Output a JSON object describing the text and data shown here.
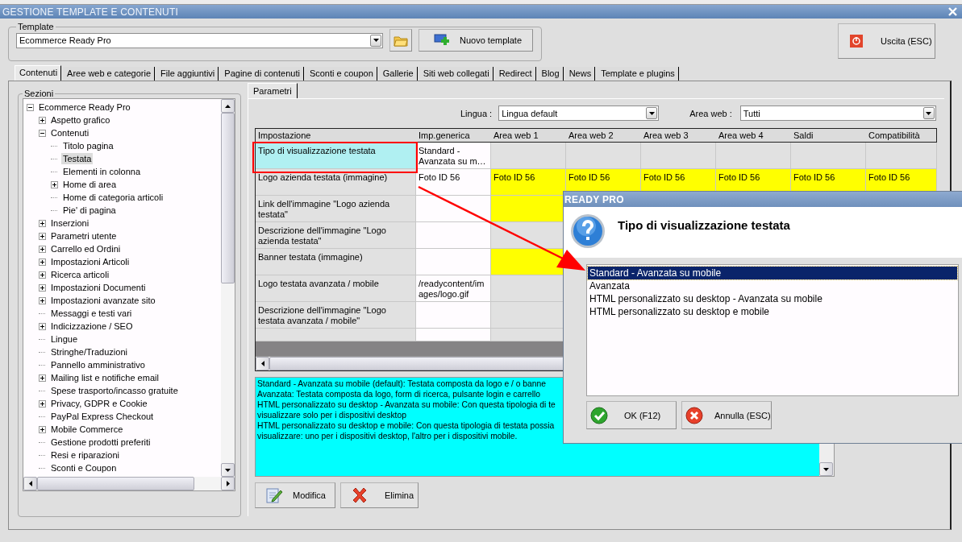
{
  "window": {
    "title": "GESTIONE TEMPLATE E CONTENUTI"
  },
  "template": {
    "label": "Template",
    "value": "Ecommerce Ready Pro",
    "new_button": "Nuovo template"
  },
  "exit_button": "Uscita (ESC)",
  "tabs": [
    {
      "label": "Contenuti",
      "selected": true
    },
    {
      "label": "Aree web e categorie",
      "selected": false
    },
    {
      "label": "File aggiuntivi",
      "selected": false
    },
    {
      "label": "Pagine di contenuti",
      "selected": false
    },
    {
      "label": "Sconti e coupon",
      "selected": false
    },
    {
      "label": "Gallerie",
      "selected": false
    },
    {
      "label": "Siti web collegati",
      "selected": false
    },
    {
      "label": "Redirect",
      "selected": false
    },
    {
      "label": "Blog",
      "selected": false
    },
    {
      "label": "News",
      "selected": false
    },
    {
      "label": "Template e plugins",
      "selected": false
    }
  ],
  "sections": {
    "label": "Sezioni",
    "tree": [
      {
        "label": "Ecommerce Ready Pro",
        "expanded": true,
        "selected": false,
        "children": [
          {
            "label": "Aspetto grafico",
            "expanded": false,
            "selected": false
          },
          {
            "label": "Contenuti",
            "expanded": true,
            "selected": false,
            "children": [
              {
                "label": "Titolo pagina",
                "selected": false
              },
              {
                "label": "Testata",
                "selected": true
              },
              {
                "label": "Elementi in colonna",
                "selected": false
              },
              {
                "label": "Home di area",
                "expanded": false,
                "selected": false
              },
              {
                "label": "Home di categoria articoli",
                "selected": false
              },
              {
                "label": "Pie' di pagina",
                "selected": false
              }
            ]
          },
          {
            "label": "Inserzioni",
            "expanded": false,
            "selected": false
          },
          {
            "label": "Parametri utente",
            "expanded": false,
            "selected": false
          },
          {
            "label": "Carrello ed Ordini",
            "expanded": false,
            "selected": false
          },
          {
            "label": "Impostazioni Articoli",
            "expanded": false,
            "selected": false
          },
          {
            "label": "Ricerca articoli",
            "expanded": false,
            "selected": false
          },
          {
            "label": "Impostazioni Documenti",
            "expanded": false,
            "selected": false
          },
          {
            "label": "Impostazioni avanzate sito",
            "expanded": false,
            "selected": false
          },
          {
            "label": "Messaggi e testi vari",
            "selected": false
          },
          {
            "label": "Indicizzazione / SEO",
            "expanded": false,
            "selected": false
          },
          {
            "label": "Lingue",
            "selected": false
          },
          {
            "label": "Stringhe/Traduzioni",
            "selected": false
          },
          {
            "label": "Pannello amministrativo",
            "selected": false
          },
          {
            "label": "Mailing list e notifiche email",
            "expanded": false,
            "selected": false
          },
          {
            "label": "Spese trasporto/incasso gratuite",
            "selected": false
          },
          {
            "label": "Privacy, GDPR e Cookie",
            "expanded": false,
            "selected": false
          },
          {
            "label": "PayPal Express Checkout",
            "selected": false
          },
          {
            "label": "Mobile Commerce",
            "expanded": false,
            "selected": false
          },
          {
            "label": "Gestione prodotti preferiti",
            "selected": false
          },
          {
            "label": "Resi e riparazioni",
            "selected": false
          },
          {
            "label": "Sconti e Coupon",
            "selected": false
          }
        ]
      }
    ]
  },
  "subtabs": [
    {
      "label": "Parametri",
      "selected": true
    }
  ],
  "filters": {
    "language_label": "Lingua :",
    "language": "Lingua default",
    "area_label": "Area web :",
    "area": "Tutti"
  },
  "grid": {
    "columns": [
      "Impostazione",
      "Imp.generica",
      "Area web 1",
      "Area web 2",
      "Area web 3",
      "Area web 4",
      "Saldi",
      "Compatibilità"
    ],
    "rows": [
      {
        "selected": true,
        "cells": [
          {
            "text": "Tipo di visualizzazione testata"
          },
          {
            "text": "Standard - Avanzata su m…"
          },
          {
            "highlighted": false
          },
          {
            "highlighted": false
          },
          {
            "highlighted": false
          },
          {
            "highlighted": false
          },
          {
            "highlighted": false
          },
          {
            "highlighted": false
          }
        ]
      },
      {
        "selected": false,
        "cells": [
          {
            "text": "Logo azienda testata (immagine)"
          },
          {
            "text": "Foto ID 56"
          },
          {
            "text": "Foto ID 56",
            "highlighted": true
          },
          {
            "text": "Foto ID 56",
            "highlighted": true
          },
          {
            "text": "Foto ID 56",
            "highlighted": true
          },
          {
            "text": "Foto ID 56",
            "highlighted": true
          },
          {
            "text": "Foto ID 56",
            "highlighted": true
          },
          {
            "text": "Foto ID 56",
            "highlighted": true
          }
        ]
      },
      {
        "selected": false,
        "cells": [
          {
            "text": "Link dell'immagine \"Logo azienda testata\""
          },
          {},
          {
            "highlighted": true
          }
        ]
      },
      {
        "selected": false,
        "cells": [
          {
            "text": "Descrizione dell'immagine \"Logo azienda testata\""
          },
          {},
          {
            "highlighted": false
          }
        ]
      },
      {
        "selected": false,
        "cells": [
          {
            "text": "Banner testata (immagine)"
          },
          {},
          {
            "highlighted": true
          }
        ]
      },
      {
        "selected": false,
        "cells": [
          {
            "text": "Logo testata avanzata / mobile"
          },
          {
            "text": "/readycontent/images/logo.gif"
          },
          {
            "highlighted": false
          }
        ]
      },
      {
        "selected": false,
        "cells": [
          {
            "text": "Descrizione dell'immagine \"Logo testata avanzata / mobile\""
          },
          {},
          {
            "highlighted": false
          }
        ]
      }
    ]
  },
  "description": "Standard - Avanzata su mobile (default): Testata composta da logo e / o banne\nAvanzata: Testata composta da logo, form di ricerca, pulsante login e carrello\nHTML personalizzato su desktop - Avanzata su mobile: Con questa tipologia di te\nvisualizzare solo per i dispositivi desktop\nHTML personalizzato su desktop e mobile: Con questa tipologia di testata possia\nvisualizzare: uno per i dispositivi desktop, l'altro per i dispositivi mobile.",
  "buttons": [
    {
      "kind": "edit",
      "label": "Modifica"
    },
    {
      "kind": "delete",
      "label": "Elimina"
    }
  ],
  "dialog": {
    "title": "READY PRO",
    "question": "Tipo di visualizzazione testata",
    "options": [
      {
        "label": "Standard - Avanzata su mobile",
        "selected": true
      },
      {
        "label": "Avanzata",
        "selected": false
      },
      {
        "label": "HTML personalizzato su desktop - Avanzata su mobile",
        "selected": false
      },
      {
        "label": "HTML personalizzato su desktop e mobile",
        "selected": false
      }
    ],
    "buttons": [
      {
        "kind": "confirm",
        "label": "OK (F12)"
      },
      {
        "kind": "cancel",
        "label": "Annulla (ESC)"
      }
    ]
  }
}
